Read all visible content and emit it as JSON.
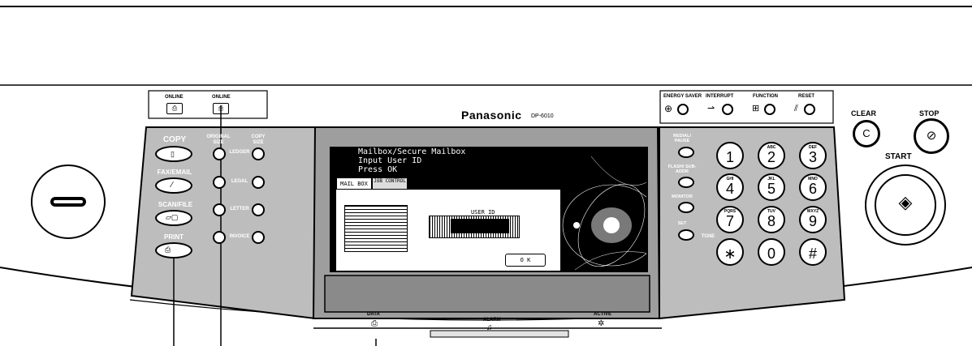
{
  "brand": {
    "name": "Panasonic",
    "model": "DP-6010"
  },
  "top_indicators": {
    "left_label": "ONLINE",
    "right_label": "ONLINE"
  },
  "mode_panel": {
    "copy": "COPY",
    "fax_email": "FAX/EMAIL",
    "scan_file": "SCAN/FILE",
    "print": "PRINT",
    "original_size_heading": "ORIGINAL SIZE",
    "copy_size_heading": "COPY SIZE",
    "sizes": [
      "LEDGER",
      "LEGAL",
      "LETTER",
      "INVOICE"
    ]
  },
  "lcd": {
    "lines": [
      "Mailbox/Secure Mailbox",
      "Input User ID",
      "Press OK"
    ],
    "tabs": [
      "MAIL BOX",
      "JOB CONTROL"
    ],
    "user_id_label": "USER ID",
    "ok_button": "O K"
  },
  "function_keys": {
    "energy_saver": "ENERGY SAVER",
    "interrupt": "INTERRUPT",
    "function": "FUNCTION",
    "reset": "RESET"
  },
  "side_keys": {
    "redial_pause": "REDIAL/ PAUSE",
    "flash": "FLASH/ SUB-ADDR",
    "monitor": "MONITOR",
    "set": "SET",
    "tone": "TONE"
  },
  "keypad": [
    {
      "digit": "1",
      "sub": ""
    },
    {
      "digit": "2",
      "sub": "ABC"
    },
    {
      "digit": "3",
      "sub": "DEF"
    },
    {
      "digit": "4",
      "sub": "GHI"
    },
    {
      "digit": "5",
      "sub": "JKL"
    },
    {
      "digit": "6",
      "sub": "MNO"
    },
    {
      "digit": "7",
      "sub": "PQRS"
    },
    {
      "digit": "8",
      "sub": "TUV"
    },
    {
      "digit": "9",
      "sub": "WXYZ"
    },
    {
      "digit": "∗",
      "sub": ""
    },
    {
      "digit": "0",
      "sub": ""
    },
    {
      "digit": "#",
      "sub": ""
    }
  ],
  "right_controls": {
    "clear": "CLEAR",
    "clear_key": "C",
    "stop": "STOP",
    "start": "START"
  },
  "bottom_leds": {
    "data": "DATA",
    "alarm": "ALARM",
    "active": "ACTIVE"
  }
}
